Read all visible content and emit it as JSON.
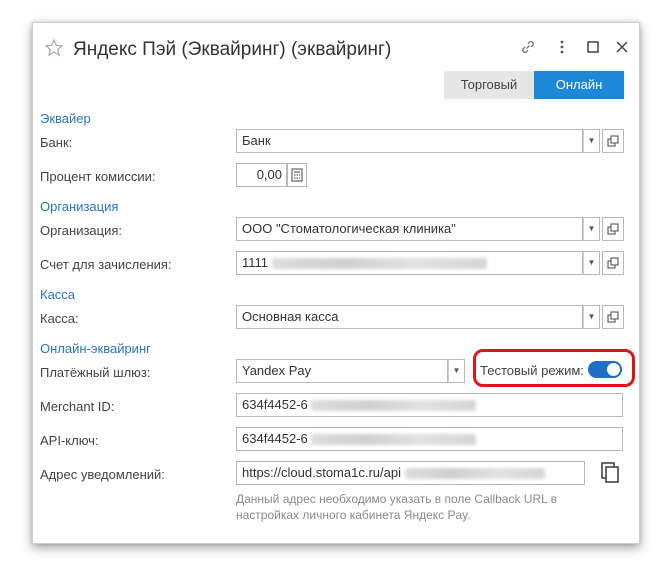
{
  "window": {
    "title": "Яндекс Пэй (Эквайринг) (эквайринг)"
  },
  "mode_tabs": [
    {
      "label": "Торговый",
      "active": false
    },
    {
      "label": "Онлайн",
      "active": true
    }
  ],
  "sections": {
    "acquirer": "Эквайер",
    "organization": "Организация",
    "cashbox": "Касса",
    "online_acquiring": "Онлайн-эквайринг"
  },
  "fields": {
    "bank": {
      "label": "Банк:",
      "value": "Банк"
    },
    "commission": {
      "label": "Процент комиссии:",
      "value": "0,00"
    },
    "organization": {
      "label": "Организация:",
      "value": "ООО \"Стоматологическая клиника\""
    },
    "account": {
      "label": "Счет для зачисления:",
      "value": "1111"
    },
    "cashbox": {
      "label": "Касса:",
      "value": "Основная касса"
    },
    "gateway": {
      "label": "Платёжный шлюз:",
      "value": "Yandex Pay"
    },
    "test_mode": {
      "label": "Тестовый режим:",
      "enabled": true
    },
    "merchant_id": {
      "label": "Merchant ID:",
      "value": "634f4452-6"
    },
    "api_key": {
      "label": "API-ключ:",
      "value": "634f4452-6"
    },
    "notify_url": {
      "label": "Адрес уведомлений:",
      "value": "https://cloud.stoma1c.ru/api"
    }
  },
  "hint": "Данный адрес необходимо указать в поле Callback URL в настройках личного кабинета Яндекс Pay.",
  "colors": {
    "accent": "#1e88d8",
    "section": "#2a74c4",
    "highlight": "#e0121a"
  }
}
